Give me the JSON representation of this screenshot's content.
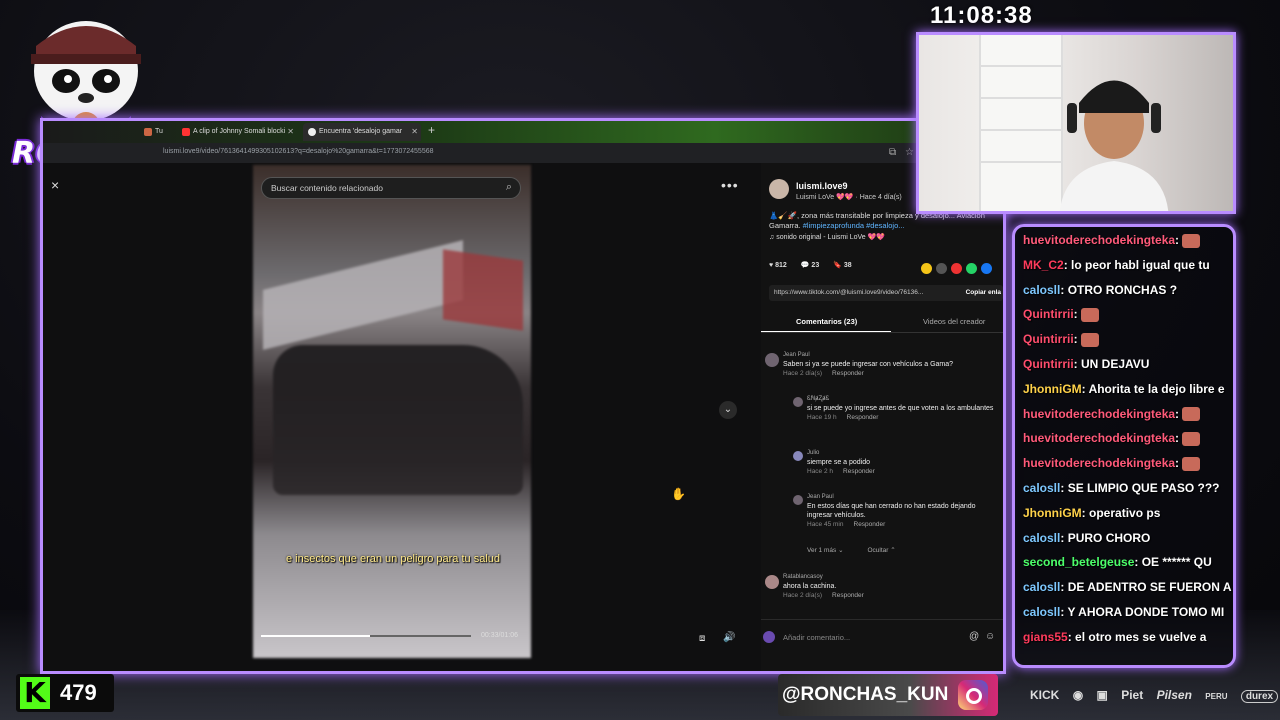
{
  "clock": "11:08:38",
  "logo_text": "RONCHAS",
  "browser": {
    "tabs": [
      {
        "label": "Tu",
        "color": "#c64"
      },
      {
        "label": "A clip of Johnny Somali blocki",
        "color": "#f33"
      },
      {
        "label": "Encuentra 'desalojo gamar",
        "color": "#eee"
      }
    ],
    "new_tab": "+",
    "url": "luismi.love9/video/7613641499305102613?q=desalojo%20gamarra&t=1773072455568"
  },
  "viewer": {
    "close": "×",
    "search_placeholder": "Buscar contenido relacionado",
    "subtitle": "e insectos que eran un peligro para tu salud",
    "time": "00:33/01:06",
    "progress": 0.52
  },
  "post": {
    "username": "luismi.love9",
    "display": "Luismi LoVe 💖💖 · Hace 4 día(s)",
    "desc_pre": "👗🧹🚀, zona más transitable por limpieza y desalojo... Aviación Gamarra. ",
    "tags": "#limpiezaprofunda #desalojo...",
    "sound": "♫ sonido original - Luismi LoVe 💖💖",
    "likes": "812",
    "comments": "23",
    "saves": "38",
    "link": "https://www.tiktok.com/@luismi.love9/video/76136...",
    "copy": "Copiar enla",
    "tab_comments": "Comentarios (23)",
    "tab_creator": "Videos del creador"
  },
  "comments": [
    {
      "user": "Jean Paul",
      "text": "Saben si ya se puede ingresar con vehículos a Gama?",
      "meta": "Hace 2 día(s)",
      "reply": "Responder"
    },
    {
      "user": "ᏋℕⱥⱫⱥᏋ",
      "text": "si se puede yo ingrese antes de que voten a los ambulantes",
      "meta": "Hace 19 h",
      "reply": "Responder"
    },
    {
      "user": "Julio",
      "text": "siempre se a podido",
      "meta": "Hace 2 h",
      "reply": "Responder"
    },
    {
      "user": "Jean Paul",
      "text": "En estos días que han cerrado no han estado dejando ingresar vehículos.",
      "meta": "Hace 45 min",
      "reply": "Responder"
    },
    {
      "user": "Ratablancasoy",
      "text": "ahora la cachina.",
      "meta": "Hace 2 día(s)",
      "reply": "Responder"
    }
  ],
  "view_more": "Ver 1 más ⌄",
  "hide": "Ocultar ⌃",
  "add_comment": "Añadir comentario...",
  "chat": [
    {
      "user": "huevitoderechodekingteka",
      "text": "",
      "color": "#ff5a7a"
    },
    {
      "user": "MK_C2",
      "text": "lo peor habl igual que tu",
      "color": "#ff3b5c"
    },
    {
      "user": "calosll",
      "text": "OTRO RONCHAS ?",
      "color": "#7ec8ff"
    },
    {
      "user": "Quintirrii",
      "text": "",
      "color": "#ff4d6d"
    },
    {
      "user": "Quintirrii",
      "text": "",
      "color": "#ff4d6d"
    },
    {
      "user": "Quintirrii",
      "text": "UN DEJAVU",
      "color": "#ff4d6d"
    },
    {
      "user": "JhonniGM",
      "text": "Ahorita te la dejo libre e",
      "color": "#ffd24a"
    },
    {
      "user": "huevitoderechodekingteka",
      "text": "",
      "color": "#ff5a7a"
    },
    {
      "user": "huevitoderechodekingteka",
      "text": "",
      "color": "#ff5a7a"
    },
    {
      "user": "huevitoderechodekingteka",
      "text": "",
      "color": "#ff5a7a"
    },
    {
      "user": "calosll",
      "text": "SE LIMPIO QUE PASO ???",
      "color": "#7ec8ff"
    },
    {
      "user": "JhonniGM",
      "text": "operativo ps",
      "color": "#ffd24a"
    },
    {
      "user": "calosll",
      "text": "PURO CHORO",
      "color": "#7ec8ff"
    },
    {
      "user": "second_betelgeuse",
      "text": "OE ****** QU",
      "color": "#4cff6a"
    },
    {
      "user": "calosll",
      "text": "DE ADENTRO SE FUERON A",
      "color": "#7ec8ff"
    },
    {
      "user": "calosll",
      "text": "Y AHORA DONDE TOMO MI",
      "color": "#7ec8ff"
    },
    {
      "user": "gians55",
      "text": "el otro mes se vuelve a",
      "color": "#ff3b5c"
    }
  ],
  "kick_count": "479",
  "handle": "@RONCHAS_KUN",
  "sponsors": [
    "KICK",
    "Piet",
    "Pilsen",
    "PERU",
    "durex"
  ]
}
